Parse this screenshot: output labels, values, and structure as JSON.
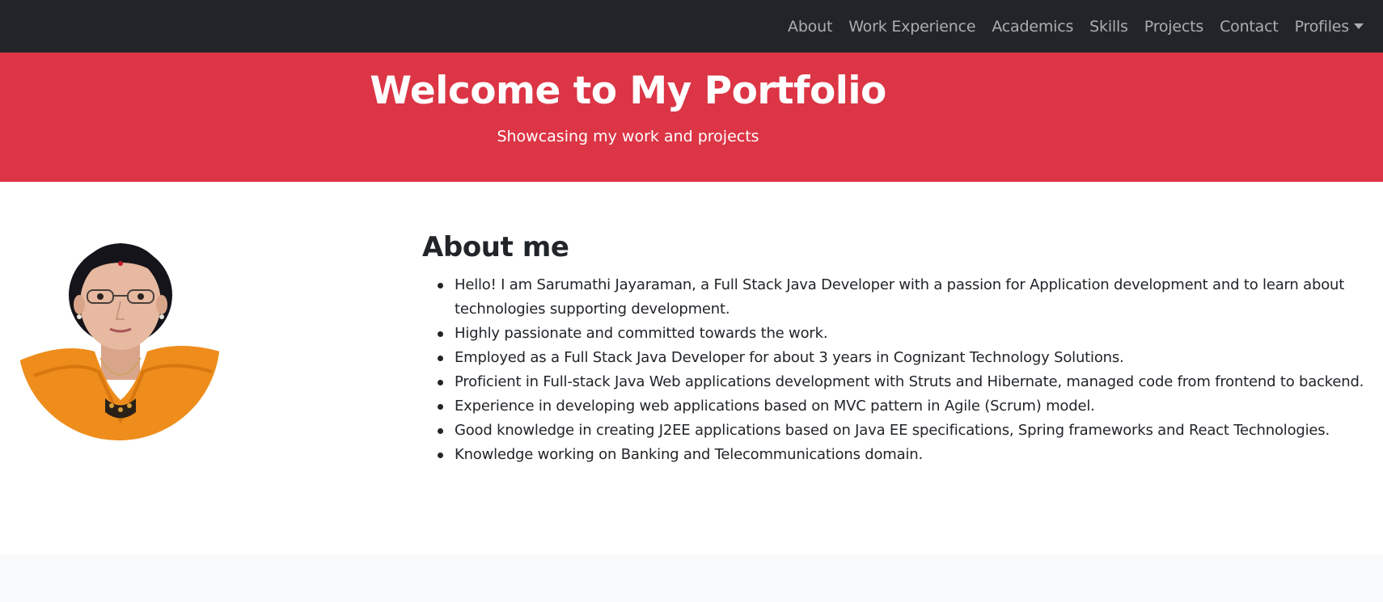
{
  "navbar": {
    "links": [
      "About",
      "Work Experience",
      "Academics",
      "Skills",
      "Projects",
      "Contact"
    ],
    "dropdown_label": "Profiles"
  },
  "hero": {
    "title": "Welcome to My Portfolio",
    "subtitle": "Showcasing my work and projects"
  },
  "about": {
    "heading": "About me",
    "items": [
      "Hello! I am Sarumathi Jayaraman, a Full Stack Java Developer with a passion for Application development and to learn about technologies supporting development.",
      "Highly passionate and committed towards the work.",
      "Employed as a Full Stack Java Developer for about 3 years in Cognizant Technology Solutions.",
      "Proficient in Full-stack Java Web applications development with Struts and Hibernate, managed code from frontend to backend.",
      "Experience in developing web applications based on MVC pattern in Agile (Scrum) model.",
      "Good knowledge in creating J2EE applications based on Java EE specifications, Spring frameworks and React Technologies.",
      "Knowledge working on Banking and Telecommunications domain."
    ]
  },
  "colors": {
    "navbar": "#212529",
    "hero": "#dc3545",
    "text": "#212529",
    "footer_band": "#f8f9fa"
  }
}
